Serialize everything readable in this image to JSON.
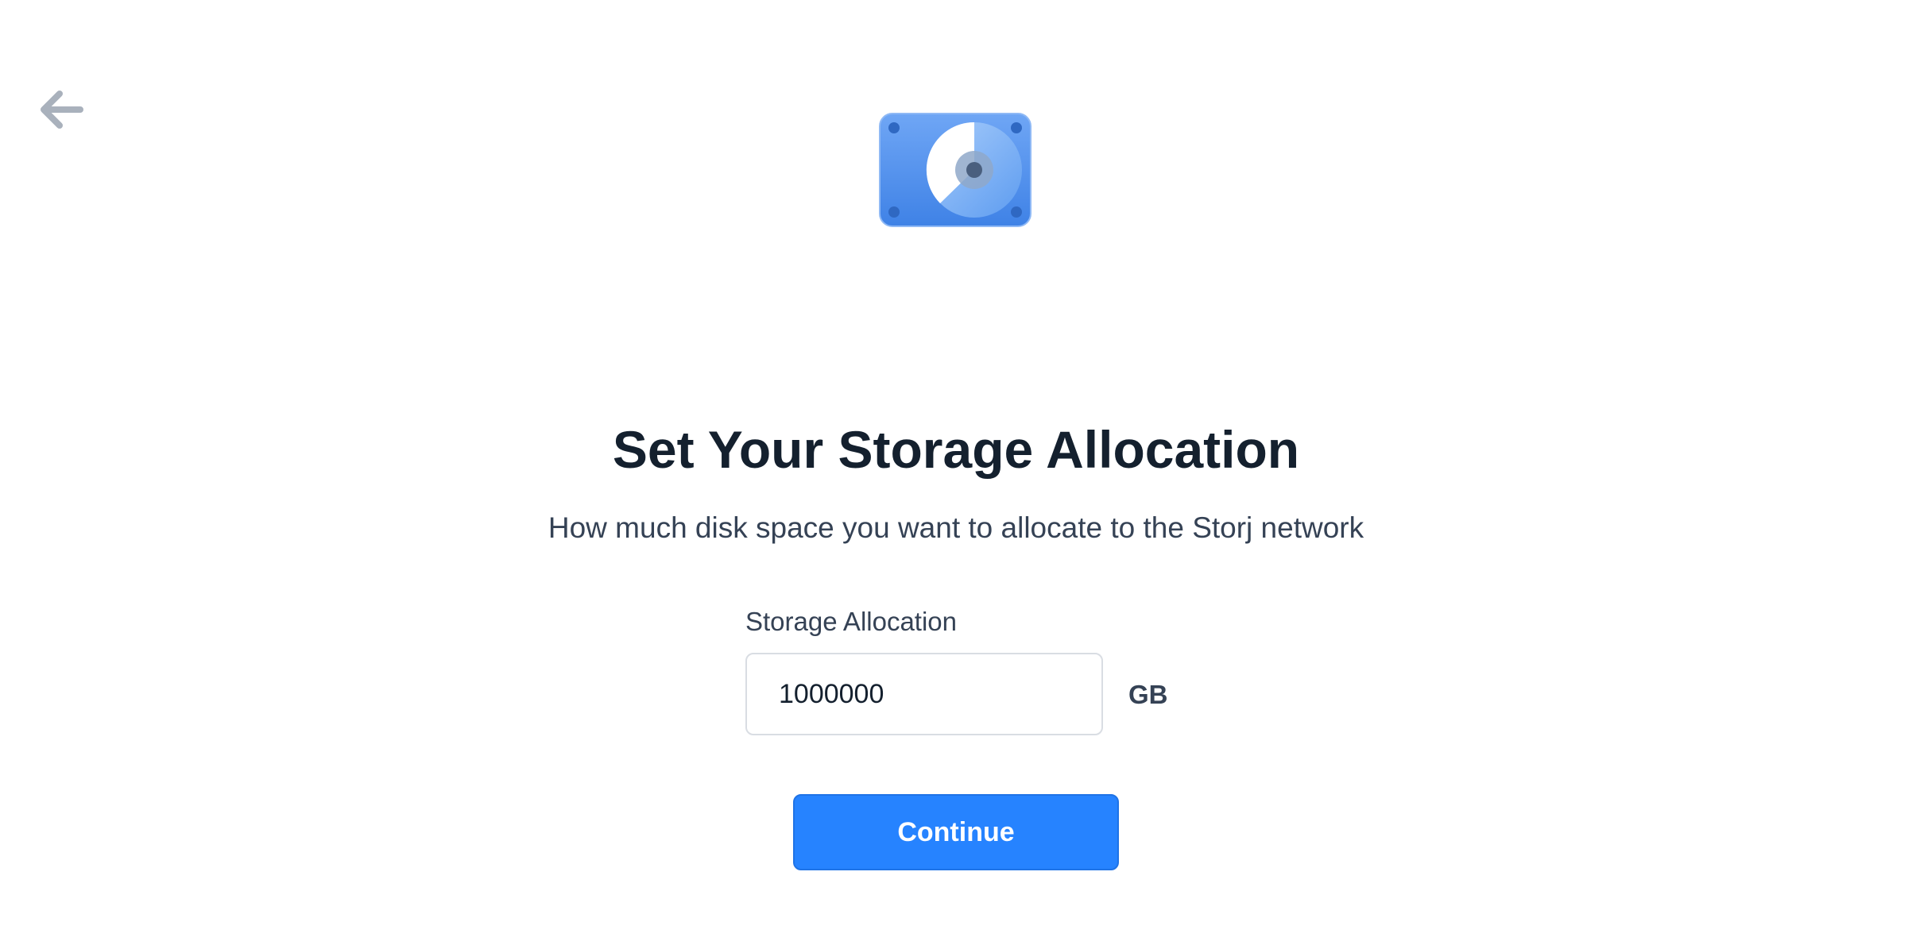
{
  "header": {
    "back_icon": "arrow-left-icon",
    "hero_icon": "hard-drive-icon"
  },
  "main": {
    "title": "Set Your Storage Allocation",
    "subtitle": "How much disk space you want to allocate to the Storj network",
    "field": {
      "label": "Storage Allocation",
      "value": "1000000",
      "unit": "GB"
    },
    "continue_label": "Continue"
  },
  "colors": {
    "accent": "#2683ff",
    "title": "#14202e",
    "text": "#354255",
    "back_arrow": "#a9b1bc"
  }
}
